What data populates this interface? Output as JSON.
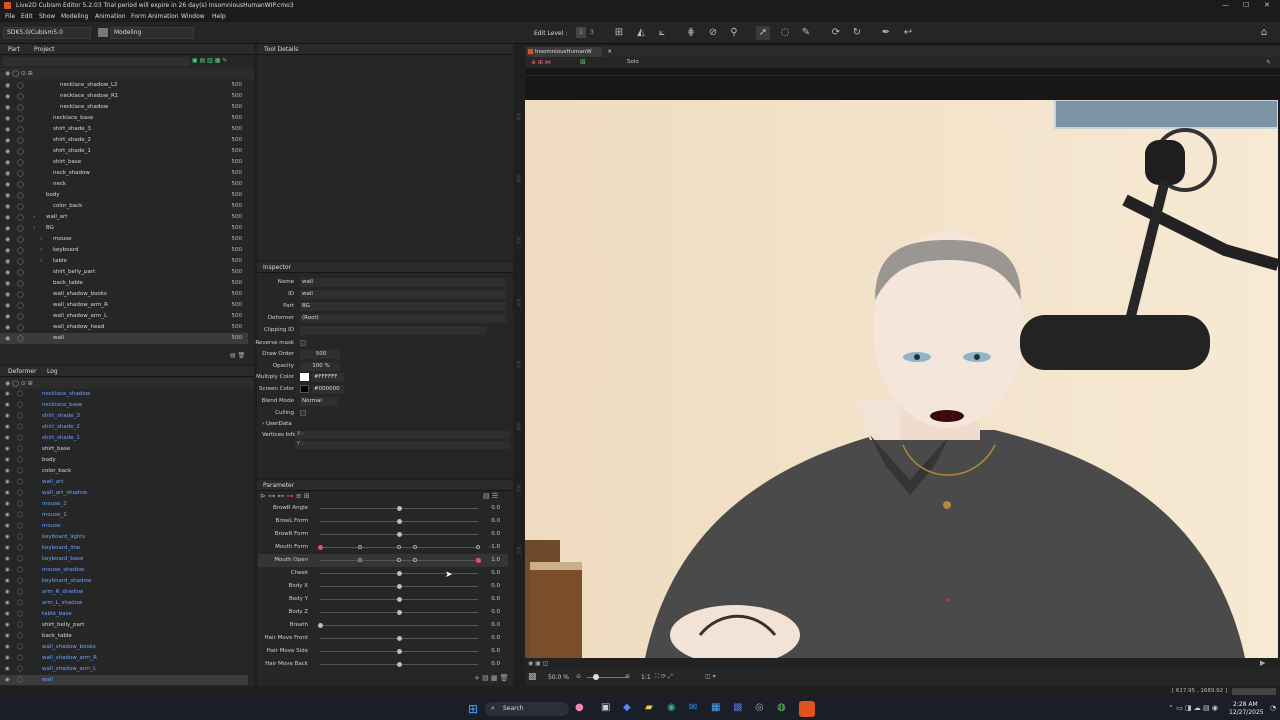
{
  "titlebar": {
    "title": "Live2D Cubism Editor 5.2.03     Trial period will expire in 26 day(s)     InsomniousHumanWIP.cmo3",
    "min": "—",
    "max": "☐",
    "close": "✕"
  },
  "menu": [
    "File",
    "Edit",
    "Show",
    "Modeling",
    "Animation",
    "Form Animation",
    "Window",
    "Help"
  ],
  "toolbar": {
    "sdk": "SDK5.0/Cubism5.0",
    "mode": "Modeling",
    "edit_level_label": "Edit Level :",
    "edit_levels": [
      "1",
      "2",
      "3"
    ]
  },
  "part_panel": {
    "tabs": [
      "Part",
      "Project"
    ],
    "rows": [
      {
        "name": "necklace_shadow_L2",
        "val": "500"
      },
      {
        "name": "necklace_shadow_R1",
        "val": "500"
      },
      {
        "name": "necklace_shadow",
        "val": "500"
      },
      {
        "name": "necklace_base",
        "val": "500"
      },
      {
        "name": "shirt_shade_3",
        "val": "500"
      },
      {
        "name": "shirt_shade_2",
        "val": "500"
      },
      {
        "name": "shirt_shade_1",
        "val": "500"
      },
      {
        "name": "shirt_base",
        "val": "500"
      },
      {
        "name": "neck_shadow",
        "val": "500"
      },
      {
        "name": "neck",
        "val": "500"
      },
      {
        "name": "body",
        "val": "500"
      },
      {
        "name": "color_back",
        "val": "500"
      },
      {
        "name": "wall_art",
        "val": "500"
      },
      {
        "name": "BG",
        "val": "500"
      },
      {
        "name": "mouse",
        "val": "500"
      },
      {
        "name": "keyboard",
        "val": "500"
      },
      {
        "name": "table",
        "val": "500"
      },
      {
        "name": "shirt_belly_part",
        "val": "500"
      },
      {
        "name": "back_table",
        "val": "500"
      },
      {
        "name": "wall_shadow_books",
        "val": "500"
      },
      {
        "name": "wall_shadow_arm_R",
        "val": "500"
      },
      {
        "name": "wall_shadow_arm_L",
        "val": "500"
      },
      {
        "name": "wall_shadow_head",
        "val": "500"
      },
      {
        "name": "wall",
        "val": "500"
      }
    ]
  },
  "deformer_panel": {
    "tabs": [
      "Deformer",
      "Log"
    ],
    "rows": [
      "necklace_shadow",
      "necklace_base",
      "shirt_shade_3",
      "shirt_shade_2",
      "shirt_shade_1",
      "shirt_base",
      "body",
      "color_back",
      "wall_art",
      "wall_art_shadow",
      "mouse_2",
      "mouse_1",
      "mouse",
      "keyboard_lights",
      "keyboard_line",
      "keyboard_base",
      "mouse_shadow",
      "keyboard_shadow",
      "arm_R_shadow",
      "arm_L_shadow",
      "table_base",
      "shirt_belly_part",
      "back_table",
      "wall_shadow_books",
      "wall_shadow_arm_R",
      "wall_shadow_arm_L",
      "wall"
    ]
  },
  "tool_details": {
    "title": "Tool Details"
  },
  "inspector": {
    "title": "Inspector",
    "name_label": "Name",
    "name": "wall",
    "id_label": "ID",
    "id": "wall",
    "part_label": "Part",
    "part": "BG",
    "deformer_label": "Deformer",
    "deformer": "(Root)",
    "clipping_label": "Clipping ID",
    "reverse_label": "Reverse mask",
    "draw_order_label": "Draw Order",
    "draw_order": "500",
    "opacity_label": "Opacity",
    "opacity": "100 %",
    "multiply_label": "Multiply Color",
    "multiply": "#FFFFFF",
    "screen_label": "Screen Color",
    "screen": "#000000",
    "blend_label": "Blend Mode",
    "blend": "Normal",
    "culling_label": "Culling",
    "userdata_label": "UserData",
    "vertices_label": "Vertices Info",
    "vx": "X :",
    "vy": "Y :"
  },
  "parameter": {
    "title": "Parameter",
    "rows": [
      {
        "name": "BrowR Angle",
        "val": "0.0"
      },
      {
        "name": "BrowL Form",
        "val": "0.0"
      },
      {
        "name": "BrowR Form",
        "val": "0.0"
      },
      {
        "name": "Mouth Form",
        "val": "-1.0"
      },
      {
        "name": "Mouth Open",
        "val": "1.0"
      },
      {
        "name": "Cheek",
        "val": "0.0"
      },
      {
        "name": "Body X",
        "val": "0.0"
      },
      {
        "name": "Body Y",
        "val": "0.0"
      },
      {
        "name": "Body Z",
        "val": "0.0"
      },
      {
        "name": "Breath",
        "val": "0.0"
      },
      {
        "name": "Hair Move Front",
        "val": "0.0"
      },
      {
        "name": "Hair Move Side",
        "val": "0.0"
      },
      {
        "name": "Hair Move Back",
        "val": "0.0"
      }
    ]
  },
  "viewport": {
    "tab": "InsomniousHumanW",
    "solo": "Solo",
    "ruler_marks": [
      "900",
      "800",
      "700",
      "600",
      "500",
      "400",
      "300",
      "200"
    ],
    "zoom": "50.0 %",
    "ratio": "1:1"
  },
  "status": {
    "coords": "[ 617.95 , 1689.92 ]"
  },
  "taskbar": {
    "search": "Search",
    "time": "2:28 AM",
    "date": "12/27/2025"
  }
}
